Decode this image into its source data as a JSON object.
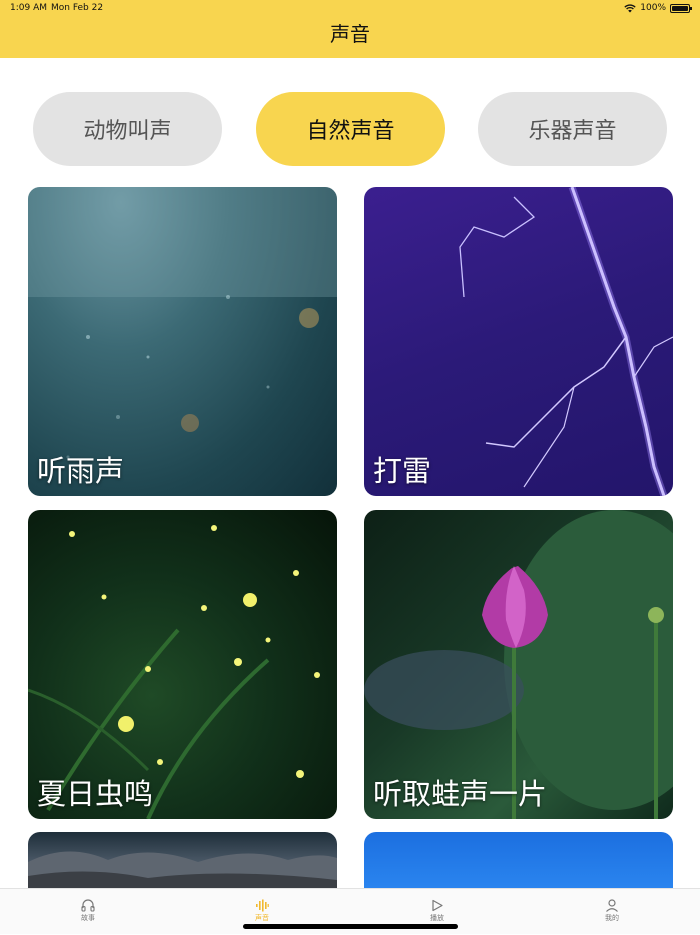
{
  "status_bar": {
    "time": "1:09 AM",
    "date": "Mon Feb 22",
    "battery": "100%"
  },
  "header": {
    "title": "声音"
  },
  "tabs": [
    {
      "label": "动物叫声",
      "active": false
    },
    {
      "label": "自然声音",
      "active": true
    },
    {
      "label": "乐器声音",
      "active": false
    }
  ],
  "cards": [
    {
      "label": "听雨声",
      "image": "rain-on-window"
    },
    {
      "label": "打雷",
      "image": "lightning"
    },
    {
      "label": "夏日虫鸣",
      "image": "fireflies-ferns"
    },
    {
      "label": "听取蛙声一片",
      "image": "lotus-bud"
    },
    {
      "label": "",
      "image": "rocks-water"
    },
    {
      "label": "",
      "image": "blue-sky"
    }
  ],
  "tab_bar": {
    "items": [
      {
        "label": "故事",
        "icon": "headphones-icon",
        "active": false
      },
      {
        "label": "声音",
        "icon": "soundwave-icon",
        "active": true
      },
      {
        "label": "播放",
        "icon": "play-icon",
        "active": false
      },
      {
        "label": "我的",
        "icon": "person-icon",
        "active": false
      }
    ]
  },
  "colors": {
    "accent": "#F8D54F",
    "tab_inactive": "#E3E3E3",
    "tab_active_text": "#F1B92F"
  }
}
